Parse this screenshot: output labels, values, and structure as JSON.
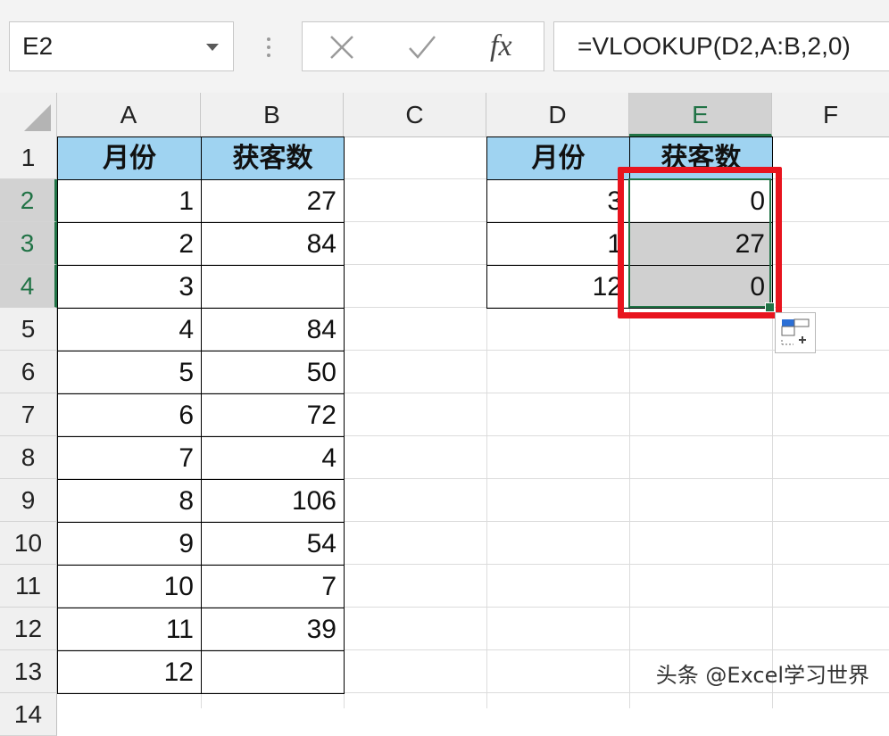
{
  "name_box": {
    "value": "E2"
  },
  "formula_bar": {
    "formula": "=VLOOKUP(D2,A:B,2,0)",
    "fx_label": "fx"
  },
  "columns": [
    "A",
    "B",
    "C",
    "D",
    "E",
    "F"
  ],
  "rows": [
    "1",
    "2",
    "3",
    "4",
    "5",
    "6",
    "7",
    "8",
    "9",
    "10",
    "11",
    "12",
    "13",
    "14"
  ],
  "table1": {
    "headers": [
      "月份",
      "获客数"
    ],
    "rows": [
      [
        "1",
        "27"
      ],
      [
        "2",
        "84"
      ],
      [
        "3",
        ""
      ],
      [
        "4",
        "84"
      ],
      [
        "5",
        "50"
      ],
      [
        "6",
        "72"
      ],
      [
        "7",
        "4"
      ],
      [
        "8",
        "106"
      ],
      [
        "9",
        "54"
      ],
      [
        "10",
        "7"
      ],
      [
        "11",
        "39"
      ],
      [
        "12",
        ""
      ]
    ]
  },
  "table2": {
    "headers": [
      "月份",
      "获客数"
    ],
    "rows": [
      [
        "3",
        "0"
      ],
      [
        "1",
        "27"
      ],
      [
        "12",
        "0"
      ]
    ]
  },
  "selection": {
    "active_cell": "E2",
    "range": "E2:E4"
  },
  "watermark": "头条 @Excel学习世界",
  "colors": {
    "header_fill": "#9fd3f1",
    "selection_green": "#217346",
    "highlight_red": "#e8141e"
  }
}
